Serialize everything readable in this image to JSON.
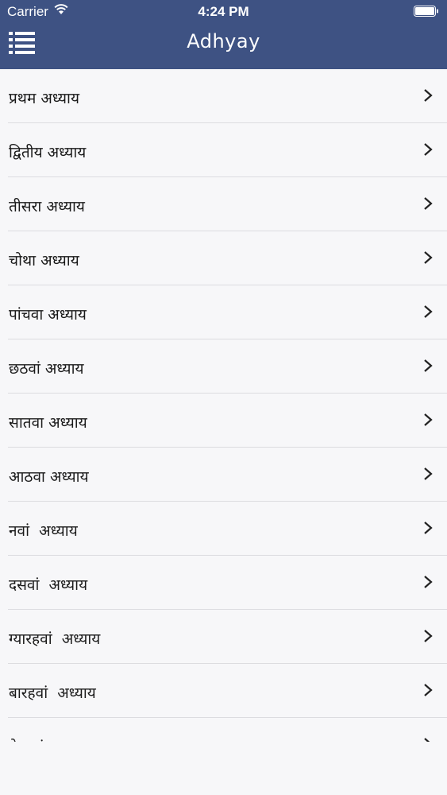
{
  "status_bar": {
    "carrier": "Carrier",
    "time": "4:24 PM"
  },
  "nav": {
    "title": "Adhyay",
    "menu_icon": "list-menu-icon"
  },
  "colors": {
    "header_bg": "#3e5283",
    "list_bg": "#f7f7f9",
    "separator": "#dcdce0"
  },
  "chapters": [
    {
      "label": "प्रथम अध्याय"
    },
    {
      "label": "द्वितीय अध्याय"
    },
    {
      "label": "तीसरा अध्याय"
    },
    {
      "label": "चोथा अध्याय"
    },
    {
      "label": "पांचवा अध्याय"
    },
    {
      "label": "छठवां अध्याय"
    },
    {
      "label": "सातवा अध्याय"
    },
    {
      "label": "आठवा अध्याय"
    },
    {
      "label": "नवां  अध्याय"
    },
    {
      "label": "दसवां  अध्याय"
    },
    {
      "label": "ग्यारहवां  अध्याय"
    },
    {
      "label": "बारहवां  अध्याय"
    },
    {
      "label": "तेरहवां  अध्याय"
    }
  ]
}
